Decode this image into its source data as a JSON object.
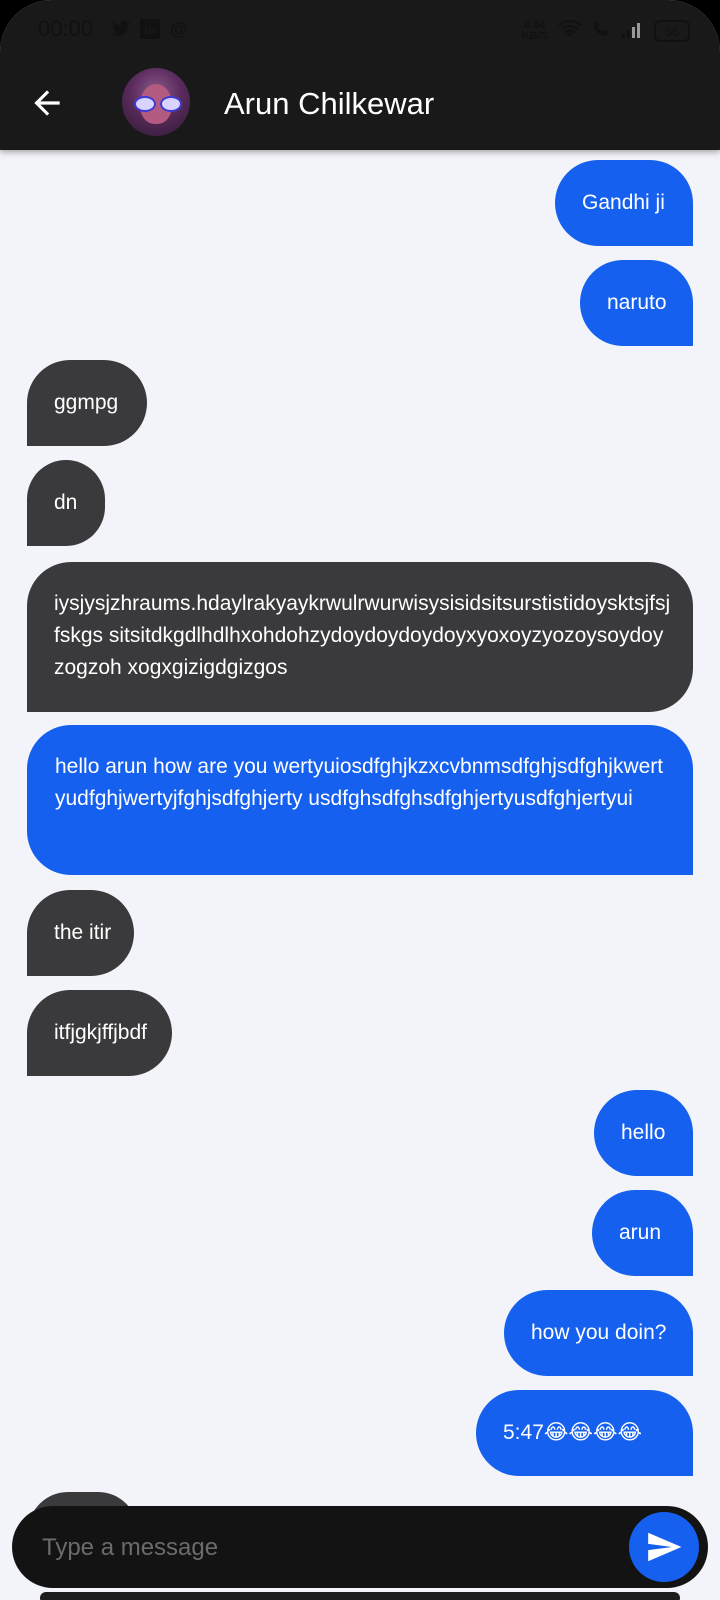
{
  "status_bar": {
    "time": "00:00",
    "left_icons": [
      "twitter-icon",
      "linkedin-icon",
      "at-icon"
    ],
    "network_speed_value": "0.04",
    "network_speed_unit": "KB/S",
    "battery": "56"
  },
  "header": {
    "contact_name": "Arun Chilkewar"
  },
  "messages": [
    {
      "id": "m1",
      "direction": "out",
      "text": "Gandhi ji"
    },
    {
      "id": "m2",
      "direction": "out",
      "text": "naruto"
    },
    {
      "id": "m3",
      "direction": "in",
      "text": "ggmpg"
    },
    {
      "id": "m4",
      "direction": "in",
      "text": "dn"
    },
    {
      "id": "m5",
      "direction": "in",
      "text": "iysjysjzhraums.hdaylrakyaykrwulrwurwisysisidsitsurstistidoysktsjfsjfskgs sitsitdkgdlhdlhxohdohzydoydoydoydoyxyoxoyzyozoysoydoyzogzoh xogxgizigdgizgos"
    },
    {
      "id": "m6",
      "direction": "out",
      "text": "hello arun how are you wertyuiosdfghjkzxcvbnmsdfghjsdfghjkwertyudfghjwertyjfghjsdfghjerty usdfghsdfghsdfghjertyusdfghjertyui"
    },
    {
      "id": "m7",
      "direction": "in",
      "text": "the itir"
    },
    {
      "id": "m8",
      "direction": "in",
      "text": "itfjgkjffjbdf"
    },
    {
      "id": "m9",
      "direction": "out",
      "text": "hello"
    },
    {
      "id": "m10",
      "direction": "out",
      "text": "arun"
    },
    {
      "id": "m11",
      "direction": "out",
      "text": "how you doin?"
    },
    {
      "id": "m12",
      "direction": "out",
      "text": "5:47😂😂😂😂"
    }
  ],
  "composer": {
    "placeholder": "Type a message"
  },
  "colors": {
    "outgoing_bubble": "#1560ee",
    "incoming_bubble": "#3a3a3c",
    "app_bar": "#191919",
    "chat_background": "#f3f4f9"
  }
}
